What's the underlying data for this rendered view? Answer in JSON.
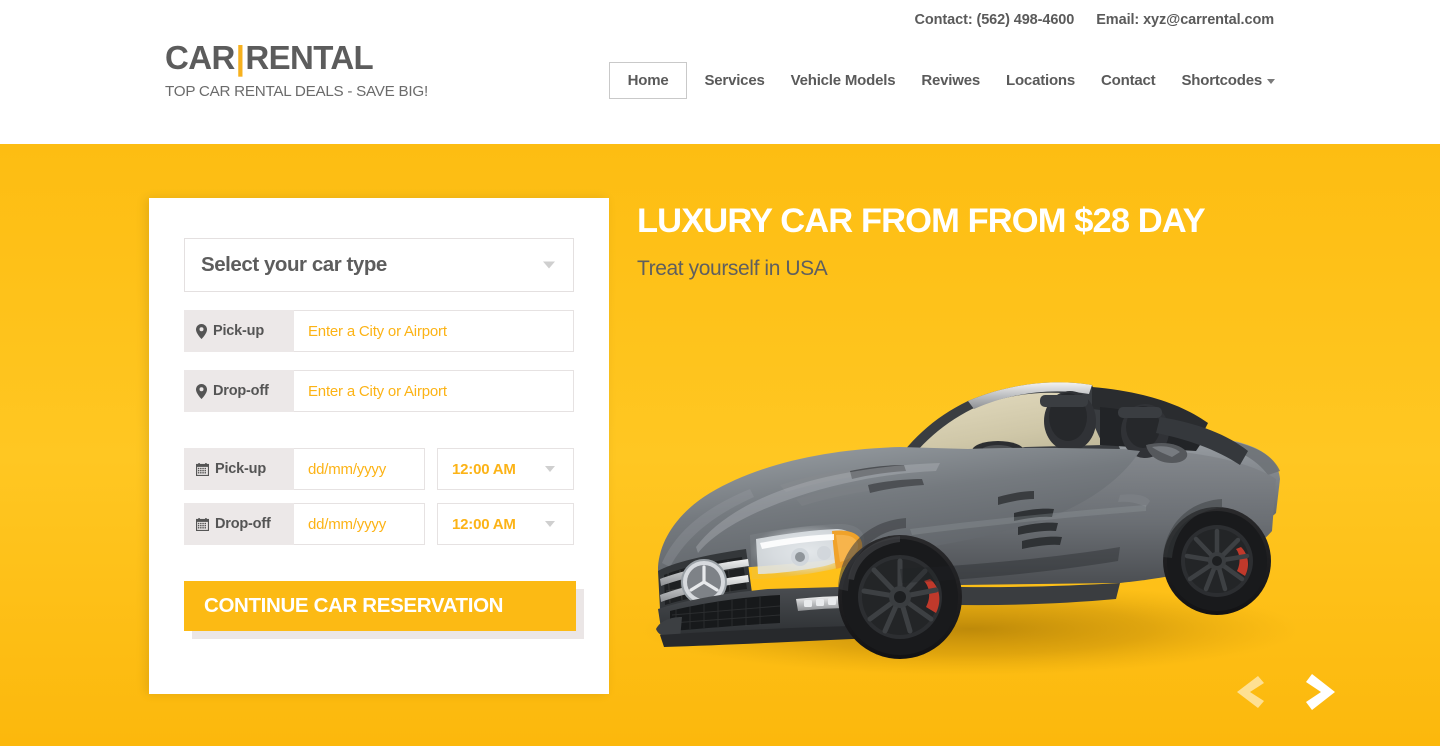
{
  "header": {
    "topbar": {
      "contact": "Contact: (562) 498-4600",
      "email": "Email: xyz@carrental.com"
    },
    "logo": {
      "part1": "CAR",
      "separator": "|",
      "part2": "RENTAL",
      "tagline": "TOP CAR RENTAL DEALS - SAVE BIG!"
    },
    "nav": [
      {
        "label": "Home",
        "active": true
      },
      {
        "label": "Services",
        "active": false
      },
      {
        "label": "Vehicle Models",
        "active": false
      },
      {
        "label": "Reviwes",
        "active": false
      },
      {
        "label": "Locations",
        "active": false
      },
      {
        "label": "Contact",
        "active": false
      },
      {
        "label": "Shortcodes",
        "active": false,
        "dropdown": true
      }
    ]
  },
  "booking": {
    "car_type": {
      "label": "Select your car type",
      "icon": "chevron-down-icon"
    },
    "pickup_location": {
      "label": "Pick-up",
      "icon": "map-pin-icon",
      "placeholder": "Enter a City or Airport",
      "value": ""
    },
    "dropoff_location": {
      "label": "Drop-off",
      "icon": "map-pin-icon",
      "placeholder": "Enter a City or Airport",
      "value": ""
    },
    "pickup_date": {
      "label": "Pick-up",
      "icon": "calendar-icon",
      "placeholder": "dd/mm/yyyy",
      "value": "",
      "time": "12:00 AM"
    },
    "dropoff_date": {
      "label": "Drop-off",
      "icon": "calendar-icon",
      "placeholder": "dd/mm/yyyy",
      "value": "",
      "time": "12:00 AM"
    },
    "submit_label": "CONTINUE CAR RESERVATION"
  },
  "hero": {
    "title": "LUXURY CAR FROM FROM $28 DAY",
    "subtitle": "Treat yourself in USA",
    "car_image_alt": "silver mercedes sl convertible",
    "prev_label": "‹",
    "next_label": "›"
  },
  "colors": {
    "brand_amber": "#fcba14",
    "hero_bg": "#ffc41f",
    "text_gray": "#5a5a5a",
    "placeholder_amber": "#fcb316",
    "field_label_bg": "#ece8e8"
  }
}
